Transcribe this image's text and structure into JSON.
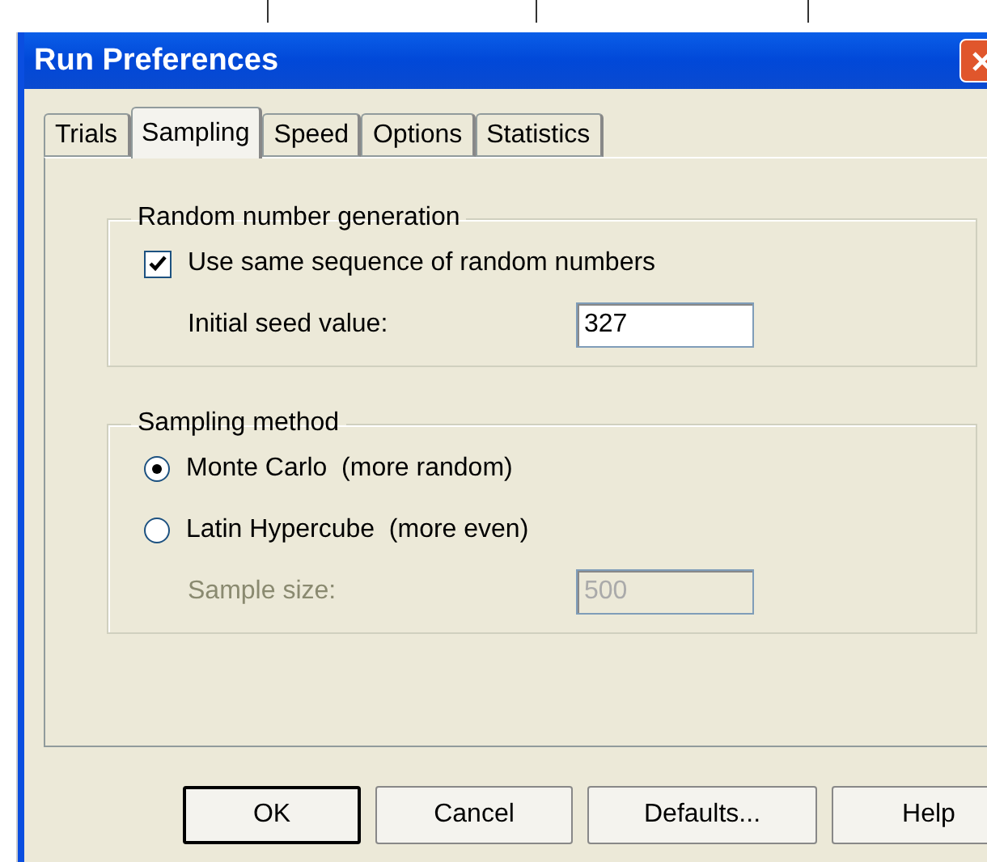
{
  "window": {
    "title": "Run Preferences"
  },
  "tabs": [
    {
      "label": "Trials",
      "selected": false
    },
    {
      "label": "Sampling",
      "selected": true
    },
    {
      "label": "Speed",
      "selected": false
    },
    {
      "label": "Options",
      "selected": false
    },
    {
      "label": "Statistics",
      "selected": false
    }
  ],
  "groups": [
    {
      "title": "Random number generation",
      "items": [
        {
          "kind": "checkbox",
          "label": "Use same sequence of random numbers",
          "checked": true
        },
        {
          "kind": "field",
          "label": "Initial seed value:",
          "value": "327",
          "disabled": false
        }
      ]
    },
    {
      "title": "Sampling method",
      "items": [
        {
          "kind": "radio",
          "label": "Monte Carlo  (more random)",
          "selected": true
        },
        {
          "kind": "radio",
          "label": "Latin Hypercube  (more even)",
          "selected": false
        },
        {
          "kind": "field",
          "label": "Sample size:",
          "value": "500",
          "disabled": true
        }
      ]
    }
  ],
  "buttons": [
    {
      "label": "OK",
      "default": true
    },
    {
      "label": "Cancel",
      "default": false
    },
    {
      "label": "Defaults...",
      "default": false
    },
    {
      "label": "Help",
      "default": false
    }
  ]
}
